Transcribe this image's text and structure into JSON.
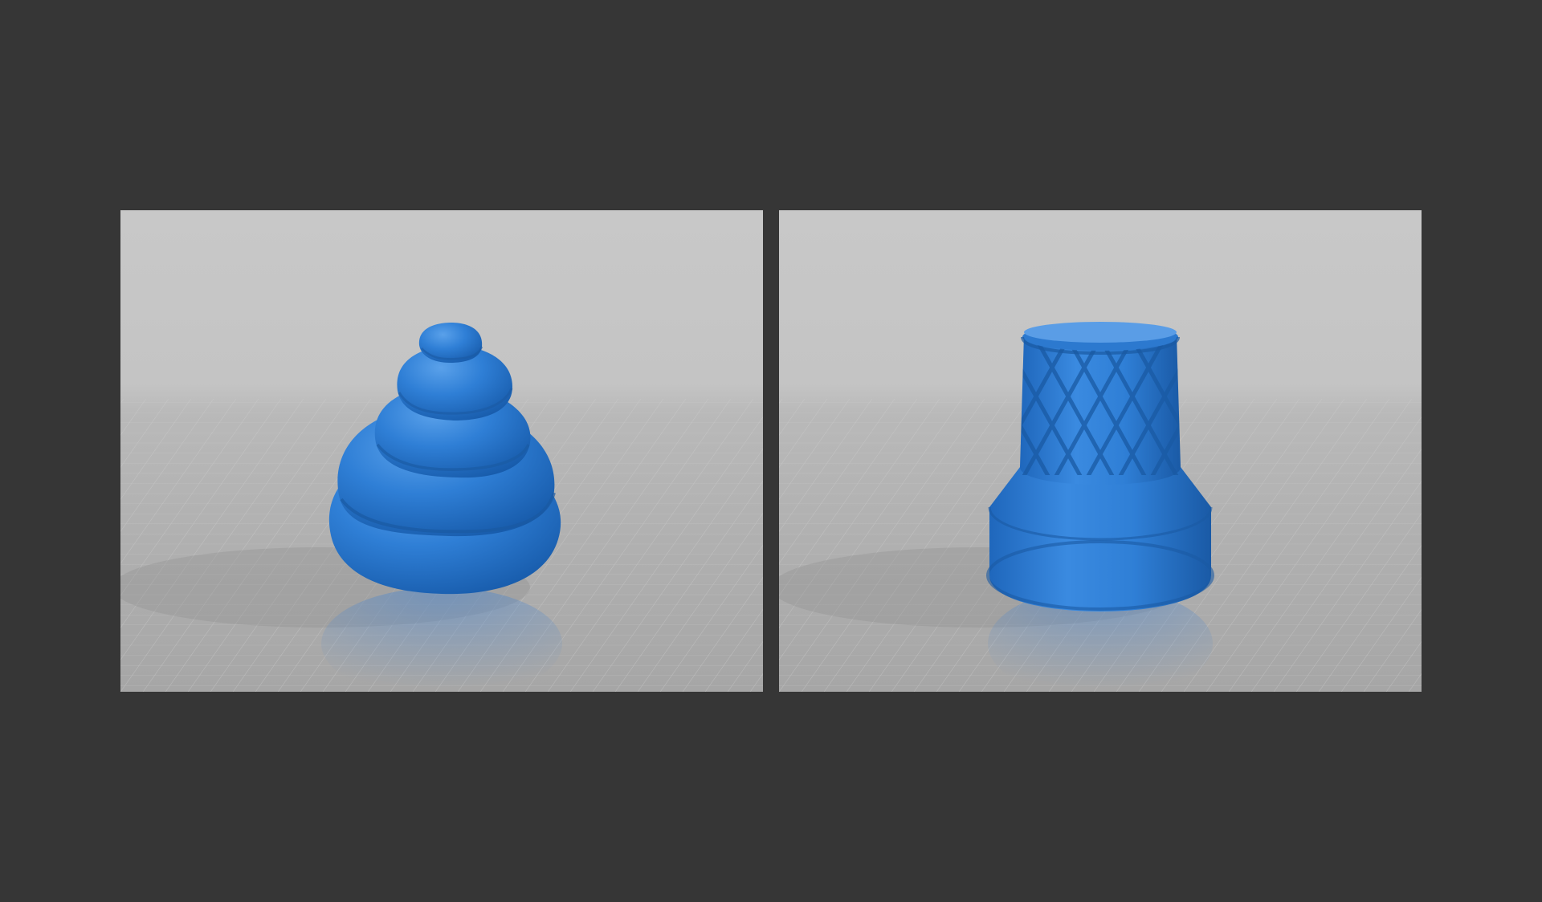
{
  "background_color": "#363636",
  "panels": [
    {
      "id": "left",
      "subject": "swirl-soft-serve-topper-model",
      "model_color": "#2f7fd6"
    },
    {
      "id": "right",
      "subject": "waffle-cone-cup-model",
      "model_color": "#2f7fd6"
    }
  ],
  "viewport": {
    "sky_color": "#c8c8c8",
    "floor_color": "#a9a9a9",
    "grid_color": "#d2d2d2"
  }
}
